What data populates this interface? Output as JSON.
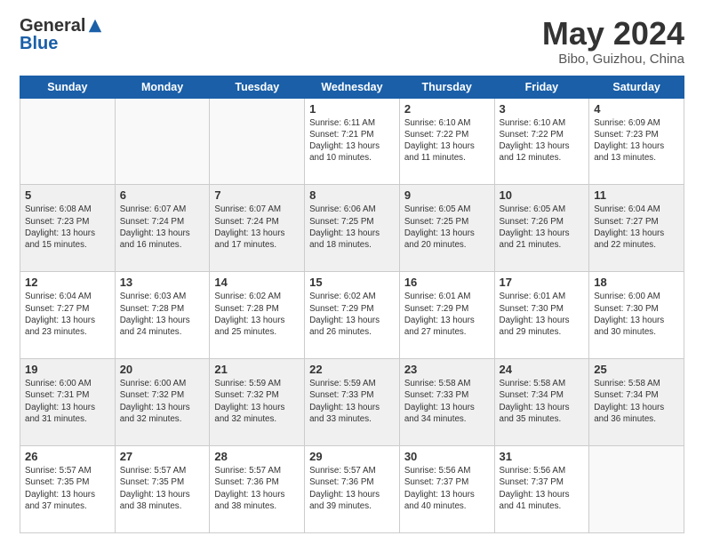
{
  "header": {
    "logo_line1": "General",
    "logo_line2": "Blue",
    "month_year": "May 2024",
    "location": "Bibo, Guizhou, China"
  },
  "weekdays": [
    "Sunday",
    "Monday",
    "Tuesday",
    "Wednesday",
    "Thursday",
    "Friday",
    "Saturday"
  ],
  "weeks": [
    {
      "shaded": false,
      "days": [
        {
          "num": "",
          "info": ""
        },
        {
          "num": "",
          "info": ""
        },
        {
          "num": "",
          "info": ""
        },
        {
          "num": "1",
          "info": "Sunrise: 6:11 AM\nSunset: 7:21 PM\nDaylight: 13 hours\nand 10 minutes."
        },
        {
          "num": "2",
          "info": "Sunrise: 6:10 AM\nSunset: 7:22 PM\nDaylight: 13 hours\nand 11 minutes."
        },
        {
          "num": "3",
          "info": "Sunrise: 6:10 AM\nSunset: 7:22 PM\nDaylight: 13 hours\nand 12 minutes."
        },
        {
          "num": "4",
          "info": "Sunrise: 6:09 AM\nSunset: 7:23 PM\nDaylight: 13 hours\nand 13 minutes."
        }
      ]
    },
    {
      "shaded": true,
      "days": [
        {
          "num": "5",
          "info": "Sunrise: 6:08 AM\nSunset: 7:23 PM\nDaylight: 13 hours\nand 15 minutes."
        },
        {
          "num": "6",
          "info": "Sunrise: 6:07 AM\nSunset: 7:24 PM\nDaylight: 13 hours\nand 16 minutes."
        },
        {
          "num": "7",
          "info": "Sunrise: 6:07 AM\nSunset: 7:24 PM\nDaylight: 13 hours\nand 17 minutes."
        },
        {
          "num": "8",
          "info": "Sunrise: 6:06 AM\nSunset: 7:25 PM\nDaylight: 13 hours\nand 18 minutes."
        },
        {
          "num": "9",
          "info": "Sunrise: 6:05 AM\nSunset: 7:25 PM\nDaylight: 13 hours\nand 20 minutes."
        },
        {
          "num": "10",
          "info": "Sunrise: 6:05 AM\nSunset: 7:26 PM\nDaylight: 13 hours\nand 21 minutes."
        },
        {
          "num": "11",
          "info": "Sunrise: 6:04 AM\nSunset: 7:27 PM\nDaylight: 13 hours\nand 22 minutes."
        }
      ]
    },
    {
      "shaded": false,
      "days": [
        {
          "num": "12",
          "info": "Sunrise: 6:04 AM\nSunset: 7:27 PM\nDaylight: 13 hours\nand 23 minutes."
        },
        {
          "num": "13",
          "info": "Sunrise: 6:03 AM\nSunset: 7:28 PM\nDaylight: 13 hours\nand 24 minutes."
        },
        {
          "num": "14",
          "info": "Sunrise: 6:02 AM\nSunset: 7:28 PM\nDaylight: 13 hours\nand 25 minutes."
        },
        {
          "num": "15",
          "info": "Sunrise: 6:02 AM\nSunset: 7:29 PM\nDaylight: 13 hours\nand 26 minutes."
        },
        {
          "num": "16",
          "info": "Sunrise: 6:01 AM\nSunset: 7:29 PM\nDaylight: 13 hours\nand 27 minutes."
        },
        {
          "num": "17",
          "info": "Sunrise: 6:01 AM\nSunset: 7:30 PM\nDaylight: 13 hours\nand 29 minutes."
        },
        {
          "num": "18",
          "info": "Sunrise: 6:00 AM\nSunset: 7:30 PM\nDaylight: 13 hours\nand 30 minutes."
        }
      ]
    },
    {
      "shaded": true,
      "days": [
        {
          "num": "19",
          "info": "Sunrise: 6:00 AM\nSunset: 7:31 PM\nDaylight: 13 hours\nand 31 minutes."
        },
        {
          "num": "20",
          "info": "Sunrise: 6:00 AM\nSunset: 7:32 PM\nDaylight: 13 hours\nand 32 minutes."
        },
        {
          "num": "21",
          "info": "Sunrise: 5:59 AM\nSunset: 7:32 PM\nDaylight: 13 hours\nand 32 minutes."
        },
        {
          "num": "22",
          "info": "Sunrise: 5:59 AM\nSunset: 7:33 PM\nDaylight: 13 hours\nand 33 minutes."
        },
        {
          "num": "23",
          "info": "Sunrise: 5:58 AM\nSunset: 7:33 PM\nDaylight: 13 hours\nand 34 minutes."
        },
        {
          "num": "24",
          "info": "Sunrise: 5:58 AM\nSunset: 7:34 PM\nDaylight: 13 hours\nand 35 minutes."
        },
        {
          "num": "25",
          "info": "Sunrise: 5:58 AM\nSunset: 7:34 PM\nDaylight: 13 hours\nand 36 minutes."
        }
      ]
    },
    {
      "shaded": false,
      "days": [
        {
          "num": "26",
          "info": "Sunrise: 5:57 AM\nSunset: 7:35 PM\nDaylight: 13 hours\nand 37 minutes."
        },
        {
          "num": "27",
          "info": "Sunrise: 5:57 AM\nSunset: 7:35 PM\nDaylight: 13 hours\nand 38 minutes."
        },
        {
          "num": "28",
          "info": "Sunrise: 5:57 AM\nSunset: 7:36 PM\nDaylight: 13 hours\nand 38 minutes."
        },
        {
          "num": "29",
          "info": "Sunrise: 5:57 AM\nSunset: 7:36 PM\nDaylight: 13 hours\nand 39 minutes."
        },
        {
          "num": "30",
          "info": "Sunrise: 5:56 AM\nSunset: 7:37 PM\nDaylight: 13 hours\nand 40 minutes."
        },
        {
          "num": "31",
          "info": "Sunrise: 5:56 AM\nSunset: 7:37 PM\nDaylight: 13 hours\nand 41 minutes."
        },
        {
          "num": "",
          "info": ""
        }
      ]
    }
  ]
}
